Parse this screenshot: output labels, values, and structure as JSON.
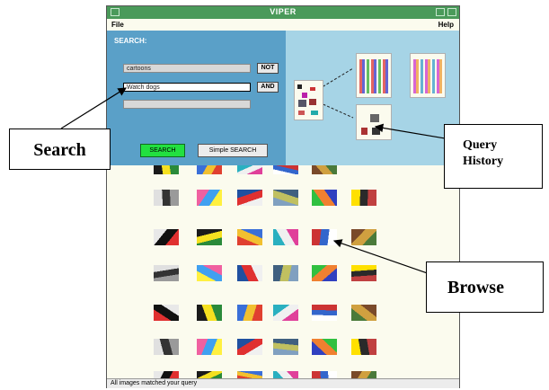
{
  "window": {
    "title": "VIPER",
    "menu": {
      "file": "File",
      "help": "Help"
    }
  },
  "search_panel": {
    "title": "SEARCH:",
    "fields": [
      "cartoons",
      "Watch dogs",
      ""
    ],
    "not_label": "NOT",
    "and_label": "AND",
    "search_button": "SEARCH",
    "simple_search_button": "Simple SEARCH"
  },
  "status": "All images matched your query",
  "annotations": {
    "search": "Search",
    "query_history_line1": "Query",
    "query_history_line2": "History",
    "browse": "Browse"
  },
  "colors": {
    "titlebar": "#4a9a5a",
    "search_panel": "#5aa0c8",
    "history_panel": "#a6d4e6",
    "search_button": "#22e040",
    "background": "#fbfbee"
  }
}
